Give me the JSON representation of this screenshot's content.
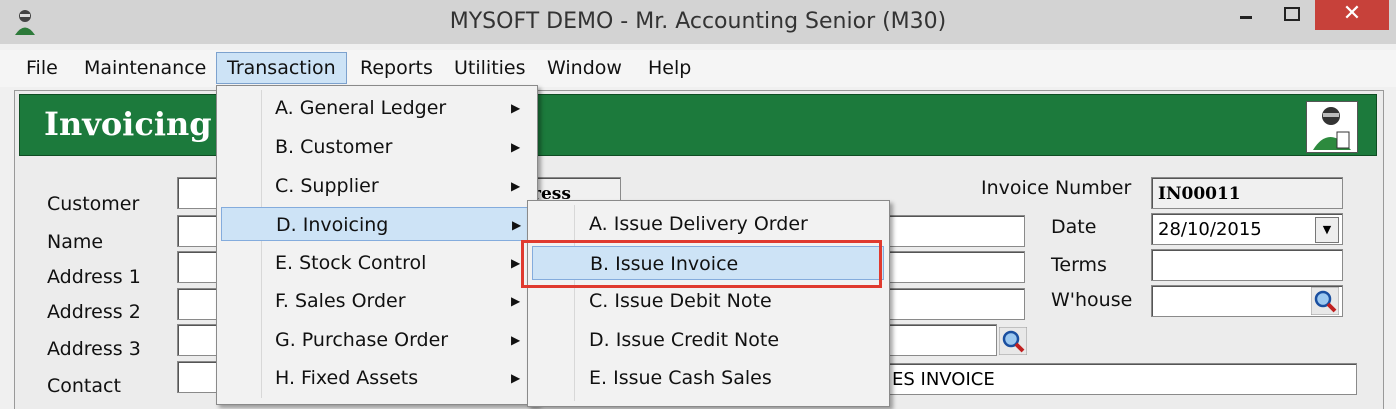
{
  "window": {
    "title": "MYSOFT DEMO - Mr. Accounting Senior (M30)",
    "close_glyph": "✕"
  },
  "menubar": [
    "File",
    "Maintenance",
    "Transaction",
    "Reports",
    "Utilities",
    "Window",
    "Help"
  ],
  "banner": {
    "title": "Invoicing"
  },
  "form": {
    "labels": [
      "Customer",
      "Name",
      "Address 1",
      "Address 2",
      "Address 3",
      "Contact"
    ],
    "partial_field_text": "ress",
    "invoice_number_label": "Invoice Number",
    "invoice_number": "IN00011",
    "date_label": "Date",
    "date_value": "28/10/2015",
    "terms_label": "Terms",
    "warehouse_label": "W'house",
    "description_partial": "ES INVOICE"
  },
  "transaction_menu": [
    {
      "label": "A. General Ledger"
    },
    {
      "label": "B. Customer"
    },
    {
      "label": "C. Supplier"
    },
    {
      "label": "D. Invoicing"
    },
    {
      "label": "E. Stock Control"
    },
    {
      "label": "F. Sales Order"
    },
    {
      "label": "G. Purchase Order"
    },
    {
      "label": "H. Fixed Assets"
    }
  ],
  "submenu_arrow": "▶",
  "invoicing_submenu": [
    {
      "label": "A. Issue Delivery Order"
    },
    {
      "label": "B. Issue Invoice"
    },
    {
      "label": "C. Issue Debit Note"
    },
    {
      "label": "D. Issue Credit Note"
    },
    {
      "label": "E. Issue Cash Sales"
    }
  ],
  "colors": {
    "banner": "#1c7a3c",
    "highlight": "#e03a2f",
    "menu_active": "#cde3f6",
    "close": "#c7413a"
  },
  "icons": [
    "app-icon",
    "minimize-icon",
    "maximize-icon",
    "close-icon",
    "magnifier-icon",
    "dropdown-arrow-icon"
  ]
}
